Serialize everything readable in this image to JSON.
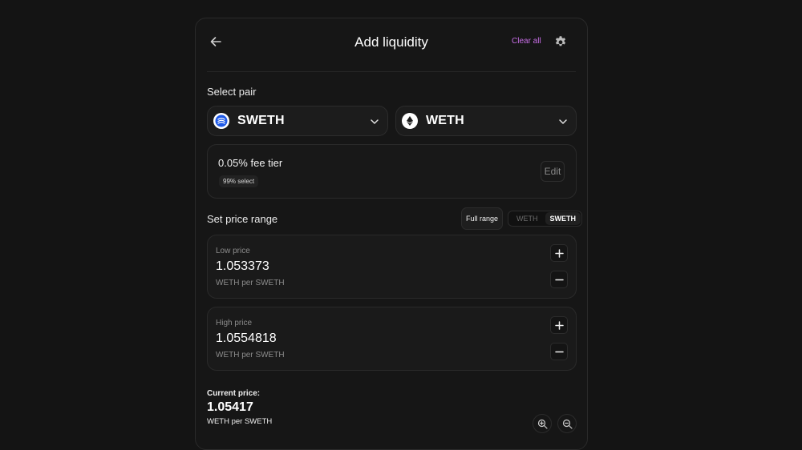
{
  "header": {
    "title": "Add liquidity",
    "clear_all_label": "Clear all",
    "back_icon": "arrow-left-icon",
    "settings_icon": "gear-icon"
  },
  "pair": {
    "section_label": "Select pair",
    "token_a": {
      "symbol": "SWETH",
      "icon": "sweth-logo-icon"
    },
    "token_b": {
      "symbol": "WETH",
      "icon": "eth-logo-icon"
    }
  },
  "fee": {
    "tier_label": "0.05% fee tier",
    "select_badge": "99% select",
    "edit_label": "Edit"
  },
  "price_range": {
    "section_label": "Set price range",
    "full_range_label": "Full range",
    "denomination_options": [
      "WETH",
      "SWETH"
    ],
    "active_denomination": "SWETH",
    "low": {
      "label": "Low price",
      "value": "1.053373",
      "unit": "WETH per SWETH"
    },
    "high": {
      "label": "High price",
      "value": "1.0554818",
      "unit": "WETH per SWETH"
    }
  },
  "current_price": {
    "label": "Current price:",
    "value": "1.05417",
    "unit": "WETH per SWETH"
  },
  "colors": {
    "accent": "#c86ee6",
    "background": "#141414",
    "panel": "#161616"
  }
}
